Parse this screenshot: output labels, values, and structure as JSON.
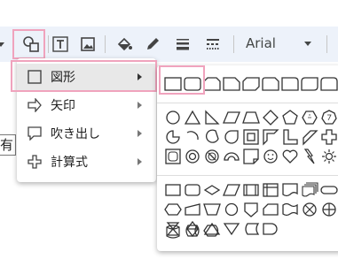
{
  "toolbar": {
    "font_name": "Arial",
    "buttons": [
      "shape-icon",
      "textbox-icon",
      "image-icon",
      "fill-color-icon",
      "pen-icon",
      "line-weight-icon",
      "line-dash-icon"
    ]
  },
  "document": {
    "visible_text": "有て"
  },
  "menu": {
    "items": [
      {
        "label": "図形",
        "icon": "rectangle-icon",
        "selected": true
      },
      {
        "label": "矢印",
        "icon": "arrow-icon",
        "selected": false
      },
      {
        "label": "吹き出し",
        "icon": "speech-bubble-icon",
        "selected": false
      },
      {
        "label": "計算式",
        "icon": "plus-icon",
        "selected": false
      }
    ]
  },
  "shapes_panel": {
    "sections": [
      "rectangles",
      "basic-shapes",
      "flowchart"
    ],
    "section1_count": 8,
    "section2_count": 27,
    "section3_count": 23
  },
  "colors": {
    "highlight": "#f0a3bd",
    "toolbar_bg": "#edf2fa",
    "selected_bg": "#e8e8e8"
  }
}
